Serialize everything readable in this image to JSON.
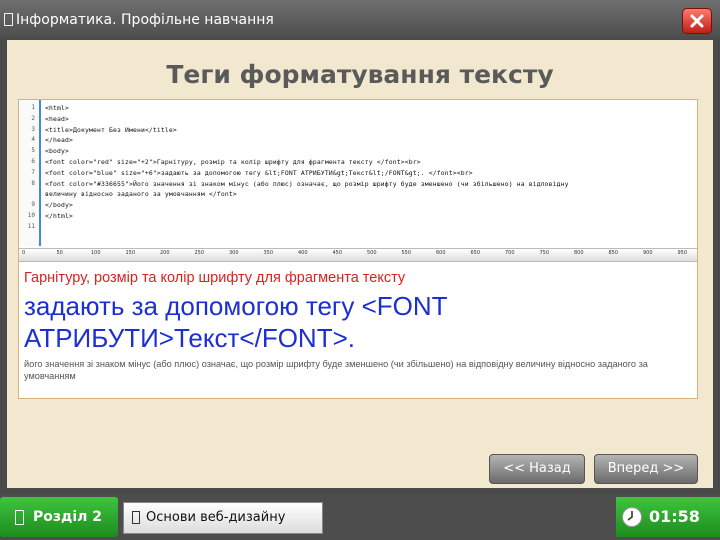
{
  "window": {
    "title": "Інформатика. Профільне навчання"
  },
  "slide": {
    "heading": "Теги форматування тексту",
    "code_lines": [
      {
        "num": "1",
        "text": "<html>"
      },
      {
        "num": "2",
        "text": "<head>"
      },
      {
        "num": "3",
        "text": "<title>Документ Без Имени</title>"
      },
      {
        "num": "4",
        "text": "</head>"
      },
      {
        "num": "5",
        "text": "<body>"
      },
      {
        "num": "6",
        "text": "<font color=\"red\" size=\"+2\">Гарнітуру, розмір та колір шрифту для фрагмента тексту </font><br>"
      },
      {
        "num": "7",
        "text": "<font color=\"blue\" size=\"+6\">задають за допомогою тегу &lt;FONT АТРИБУТИ&gt;Текст&lt;/FONT&gt;. </font><br>"
      },
      {
        "num": "8",
        "text": "<font color=\"#336655\">Його значення зі знаком мінус (або плюс) означає, що розмір шрифту буде зменшено (чи збільшено) на відповідну"
      },
      {
        "num": "",
        "text": "величину відносно заданого за умовчанням </font>"
      },
      {
        "num": "9",
        "text": "</body>"
      },
      {
        "num": "10",
        "text": "</html>"
      },
      {
        "num": "11",
        "text": ""
      }
    ],
    "ruler_ticks": [
      "0",
      "50",
      "100",
      "150",
      "200",
      "250",
      "300",
      "350",
      "400",
      "450",
      "500",
      "550",
      "600",
      "650",
      "700",
      "750",
      "800",
      "850",
      "900",
      "950"
    ],
    "caption_small": "Гарнітуру, розмір та колір шрифту для фрагмента тексту",
    "caption_big": "задають за допомогою тегу <FONT АТРИБУТИ>Текст</FONT>.",
    "caption_note": "його значення зі знаком мінус (або плюс) означає, що розмір шрифту буде зменшено (чи збільшено) на відповідну величину відносно заданого за умовчанням",
    "back_label": "<< Назад",
    "forward_label": "Вперед >>"
  },
  "footer": {
    "section_label": "Розділ 2",
    "topic_label": "Основи веб-дизайну",
    "timer": "01:58"
  },
  "colors": {
    "accent_green": "#2aa82a",
    "slide_bg": "#f2e8d0",
    "caption_red": "#d9231d",
    "caption_blue": "#1b2fd4",
    "close_red": "#d9281c"
  },
  "icons": [
    "document-icon",
    "close-icon",
    "clock-icon"
  ]
}
